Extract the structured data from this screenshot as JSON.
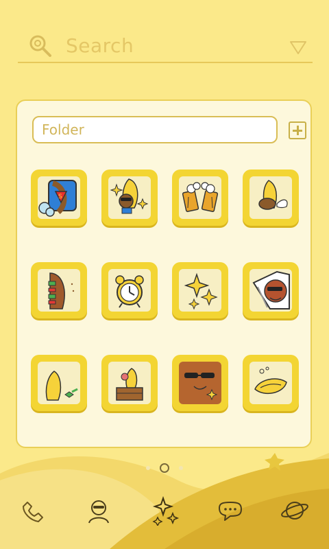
{
  "search": {
    "placeholder": "Search"
  },
  "folder": {
    "name_placeholder": "Folder"
  },
  "apps": [
    {
      "icon": "superhero-banana-icon"
    },
    {
      "icon": "sunglasses-banana-icon"
    },
    {
      "icon": "beer-mugs-icon"
    },
    {
      "icon": "winged-banana-icon"
    },
    {
      "icon": "sandwich-icon"
    },
    {
      "icon": "alarm-clock-icon"
    },
    {
      "icon": "sparkles-icon"
    },
    {
      "icon": "peeking-character-icon"
    },
    {
      "icon": "banana-peel-icon"
    },
    {
      "icon": "banana-in-box-icon"
    },
    {
      "icon": "cool-face-icon"
    },
    {
      "icon": "sleeping-banana-icon"
    }
  ],
  "pages": {
    "count": 3,
    "current": 2
  },
  "dock": [
    {
      "icon": "phone-icon"
    },
    {
      "icon": "contacts-icon"
    },
    {
      "icon": "sparkle-apps-icon"
    },
    {
      "icon": "message-icon"
    },
    {
      "icon": "planet-browser-icon"
    }
  ],
  "colors": {
    "background": "#fbe98a",
    "accent": "#f3d533",
    "line": "#e6c85a"
  }
}
